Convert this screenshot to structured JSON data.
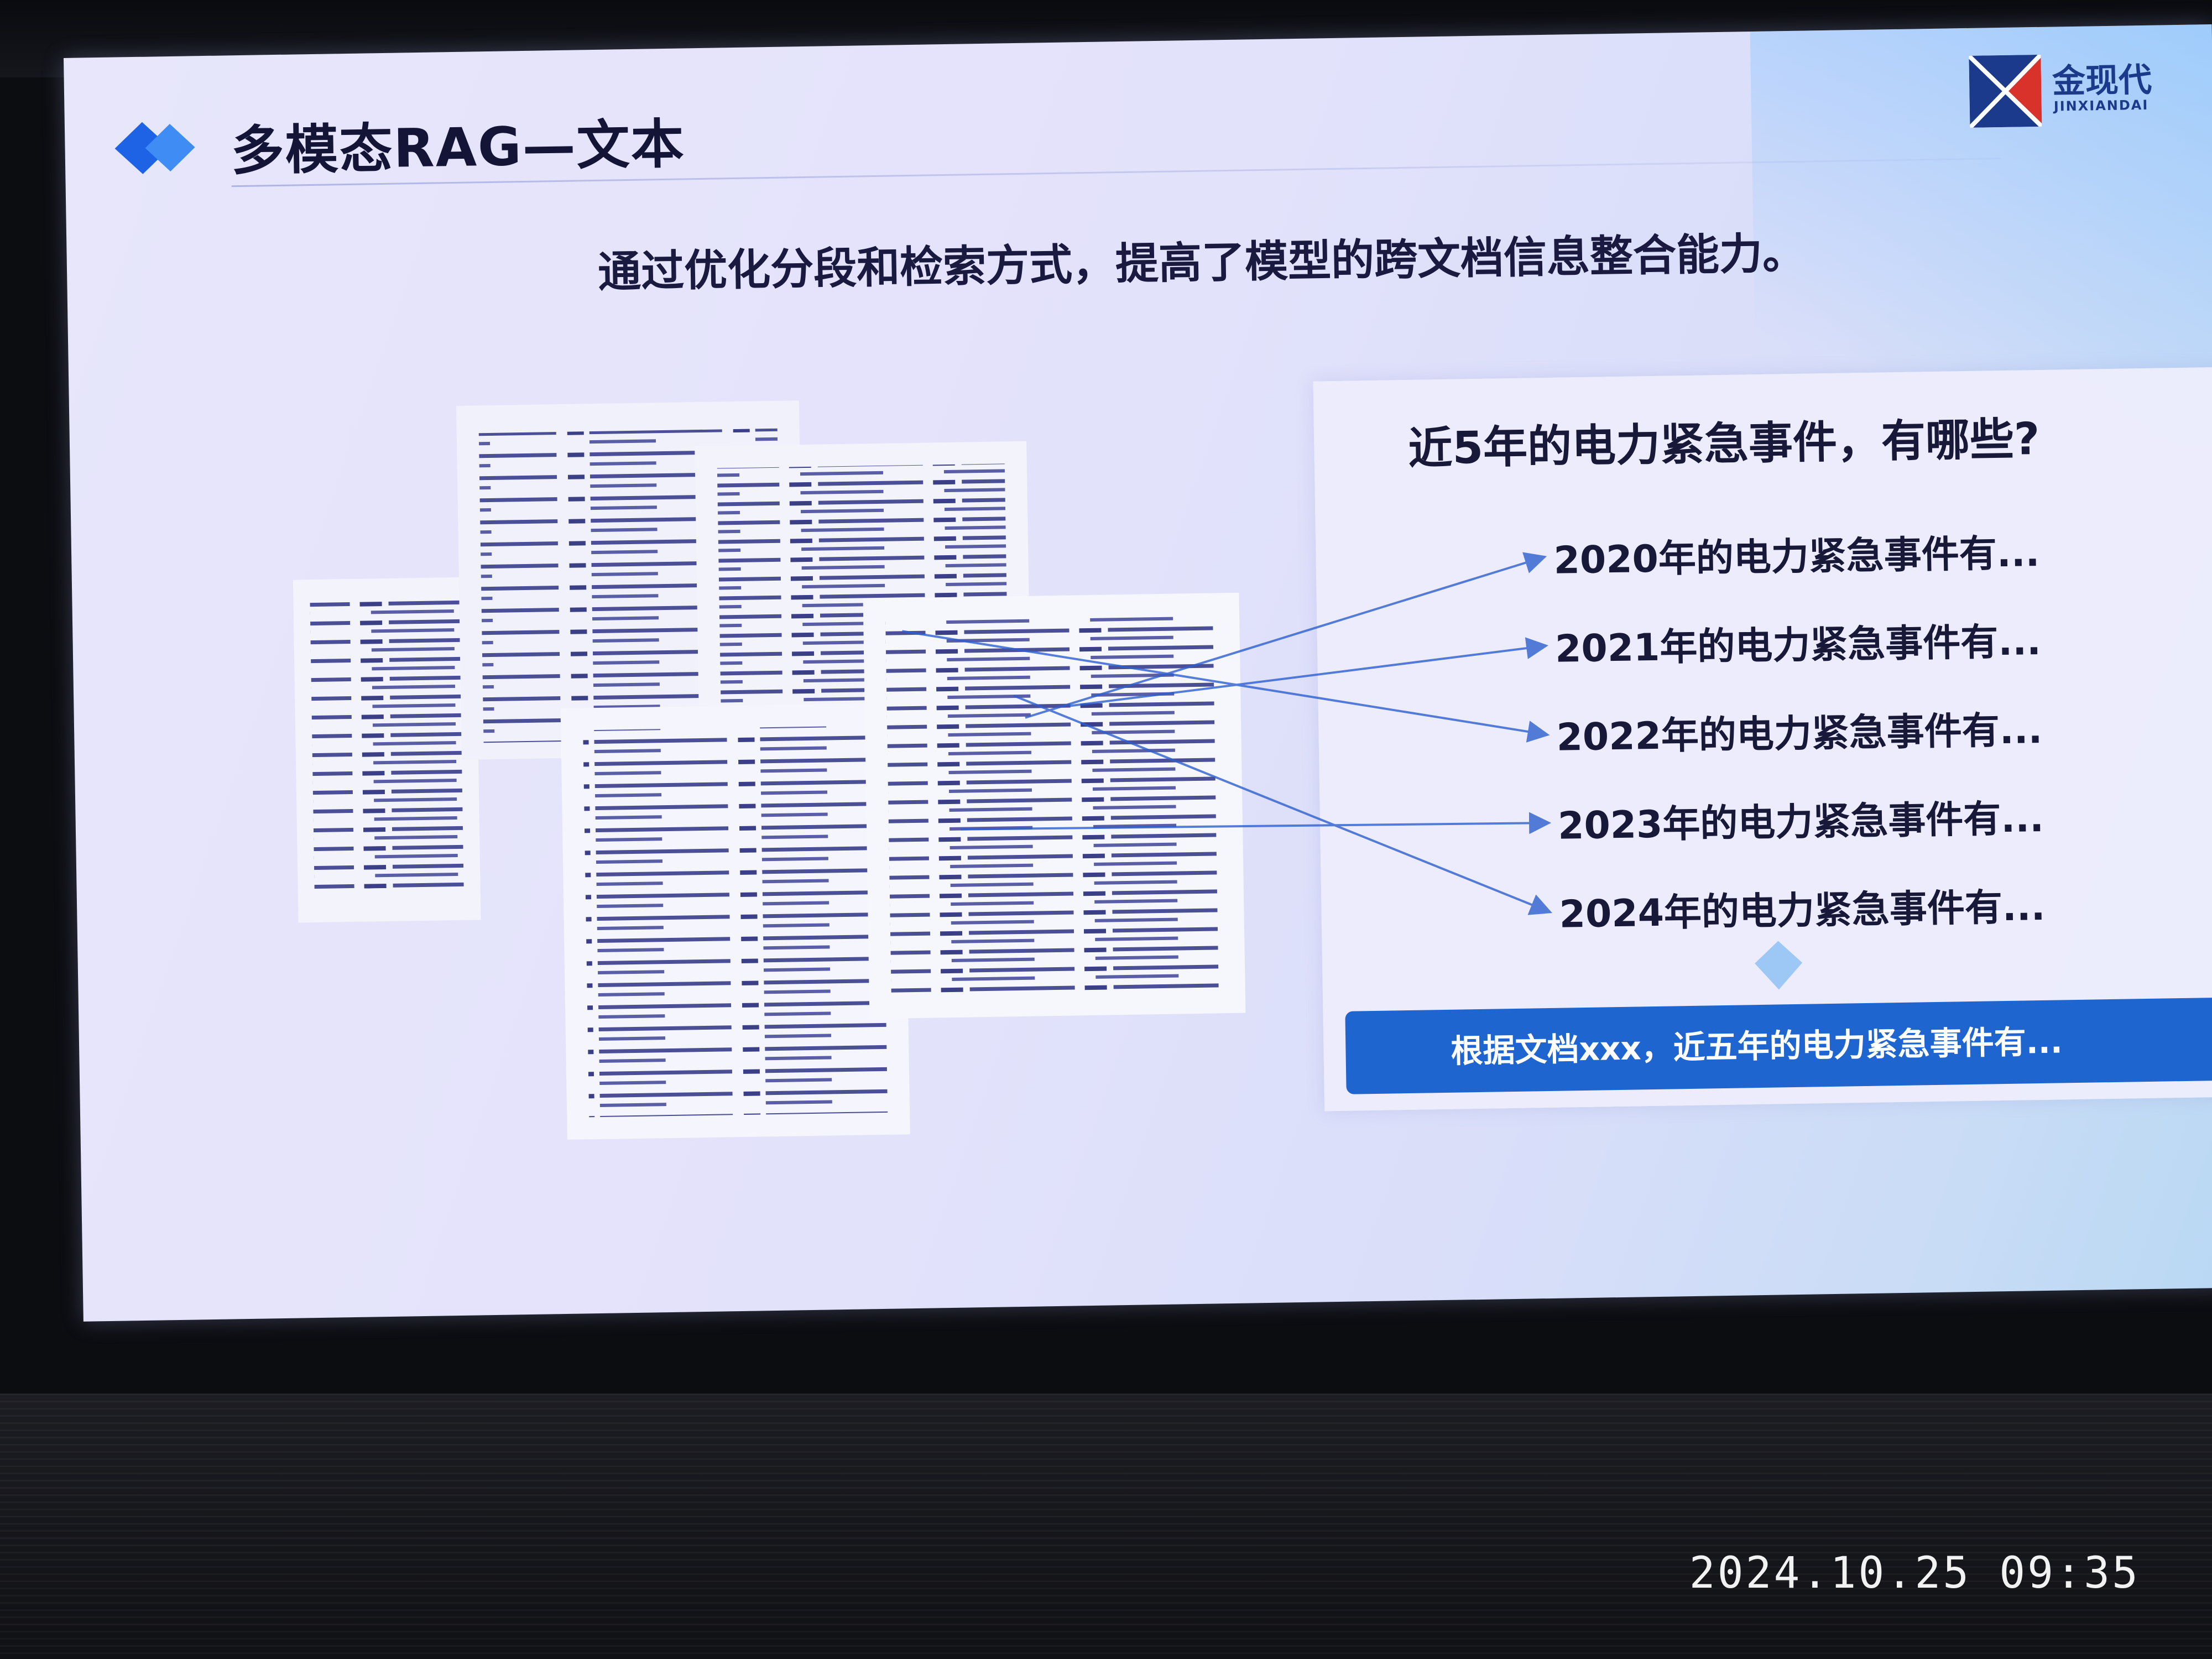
{
  "slide": {
    "title": "多模态RAG—文本",
    "subtitle": "通过优化分段和检索方式，提高了模型的跨文档信息整合能力。",
    "logo": {
      "name": "金现代",
      "pinyin": "JINXIANDAI"
    },
    "question": "近5年的电力紧急事件，有哪些?",
    "answers": [
      "2020年的电力紧急事件有...",
      "2021年的电力紧急事件有...",
      "2022年的电力紧急事件有...",
      "2023年的电力紧急事件有...",
      "2024年的电力紧急事件有..."
    ],
    "result": "根据文档xxx，近五年的电力紧急事件有..."
  },
  "photo": {
    "timestamp": "2024.10.25   09:35"
  },
  "colors": {
    "accent": "#1f65cf",
    "title_text": "#141436",
    "connector": "#2c5fcf"
  }
}
